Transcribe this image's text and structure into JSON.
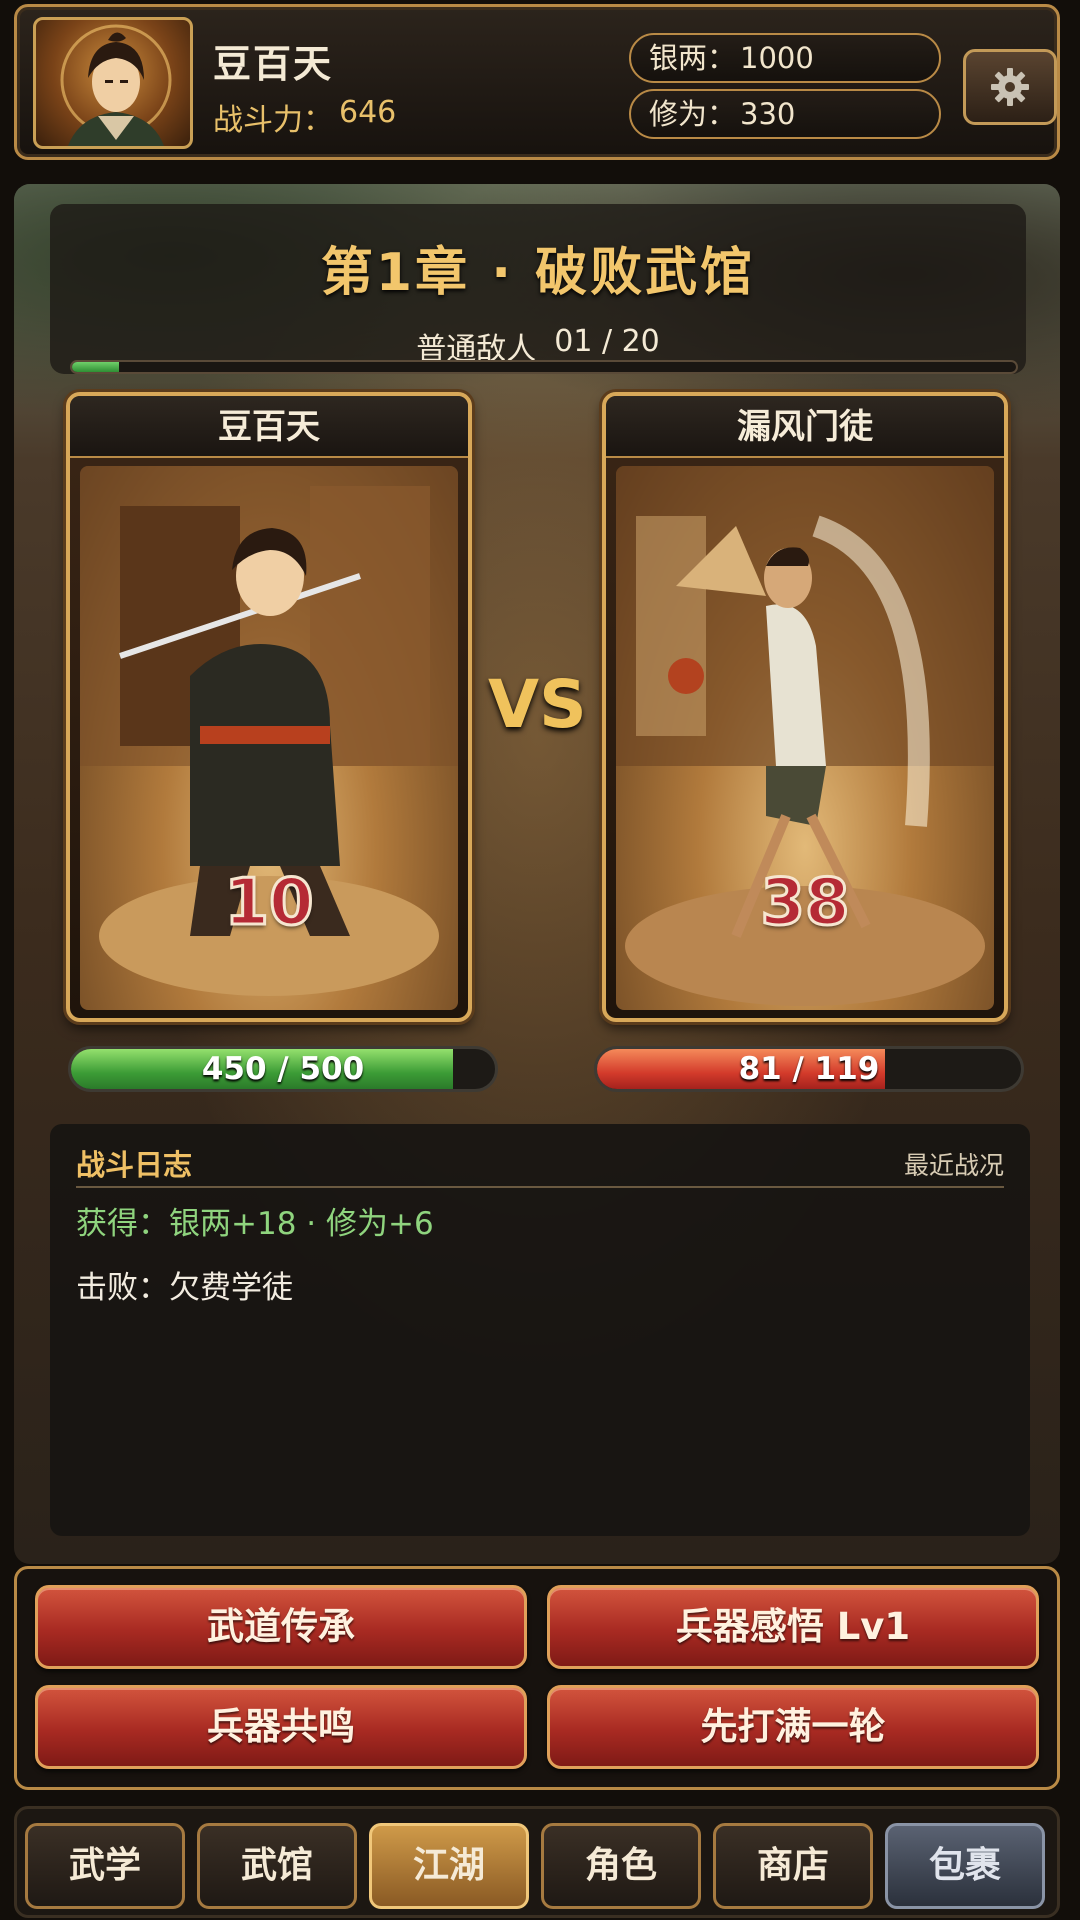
{
  "player": {
    "name": "豆百天",
    "power_label": "战斗力：",
    "power_value": "646",
    "silver_label": "银两：",
    "silver_value": "1000",
    "cultivation_label": "修为：",
    "cultivation_value": "330"
  },
  "chapter": {
    "title": "第1章 · 破败武馆",
    "enemy_type": "普通敌人",
    "enemy_progress": "01 / 20",
    "progress_fraction": 0.05
  },
  "battle": {
    "vs": "VS",
    "left": {
      "name": "豆百天",
      "level": "10",
      "hp_text": "450 / 500",
      "hp_fraction": 0.9
    },
    "right": {
      "name": "漏风门徒",
      "level": "38",
      "hp_text": "81 / 119",
      "hp_fraction": 0.68
    }
  },
  "log": {
    "title": "战斗日志",
    "recent_label": "最近战况",
    "lines": [
      "获得：银两+18 · 修为+6",
      "击败：欠费学徒"
    ]
  },
  "actions": [
    "武道传承",
    "兵器感悟 Lv1",
    "兵器共鸣",
    "先打满一轮"
  ],
  "nav": {
    "tabs": [
      "武学",
      "武馆",
      "江湖",
      "角色",
      "商店",
      "包裹"
    ],
    "active": "江湖"
  },
  "icons": {
    "settings": "gear-icon",
    "avatar": "player-portrait"
  }
}
